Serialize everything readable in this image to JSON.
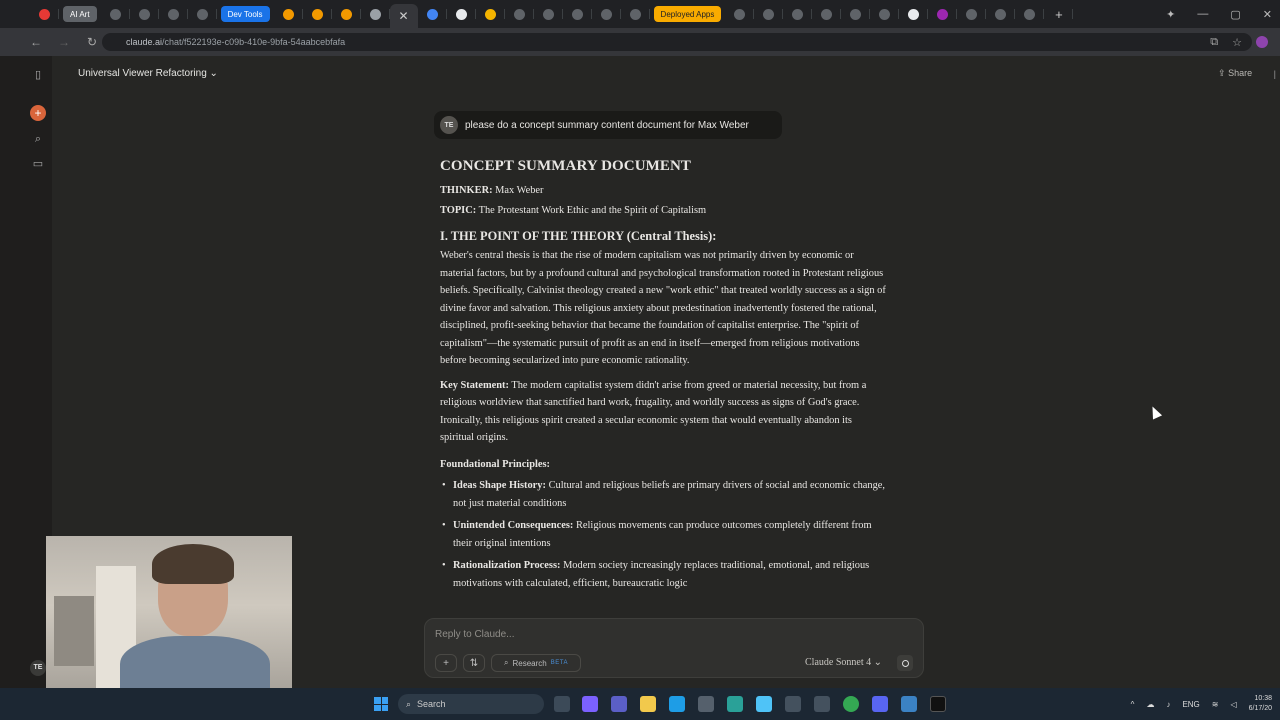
{
  "browser": {
    "pinned_tabs": [
      "AI Art",
      "Dev Tools",
      "Deployed Apps"
    ],
    "url_host": "claude.ai",
    "url_path": "/chat/f522193e-c09b-410e-9bfa-54aabcebfafa"
  },
  "header": {
    "chat_title": "Universal Viewer Refactoring",
    "share_label": "Share"
  },
  "user": {
    "initials": "TE",
    "message": "please do a  concept summary content document for Max Weber"
  },
  "document": {
    "title": "CONCEPT SUMMARY DOCUMENT",
    "thinker_label": "THINKER:",
    "thinker": "Max Weber",
    "topic_label": "TOPIC:",
    "topic": "The Protestant Work Ethic and the Spirit of Capitalism",
    "section1_heading": "I. THE POINT OF THE THEORY (Central Thesis):",
    "section1_body": "Weber's central thesis is that the rise of modern capitalism was not primarily driven by economic or material factors, but by a profound cultural and psychological transformation rooted in Protestant religious beliefs. Specifically, Calvinist theology created a new \"work ethic\" that treated worldly success as a sign of divine favor and salvation. This religious anxiety about predestination inadvertently fostered the rational, disciplined, profit-seeking behavior that became the foundation of capitalist enterprise. The \"spirit of capitalism\"—the systematic pursuit of profit as an end in itself—emerged from religious motivations before becoming secularized into pure economic rationality.",
    "key_label": "Key Statement:",
    "key_body": "The modern capitalist system didn't arise from greed or material necessity, but from a religious worldview that sanctified hard work, frugality, and worldly success as signs of God's grace. Ironically, this religious spirit created a secular economic system that would eventually abandon its spiritual origins.",
    "principles_heading": "Foundational Principles:",
    "principles": [
      {
        "label": "Ideas Shape History:",
        "text": "Cultural and religious beliefs are primary drivers of social and economic change, not just material conditions"
      },
      {
        "label": "Unintended Consequences:",
        "text": "Religious movements can produce outcomes completely different from their original intentions"
      },
      {
        "label": "Rationalization Process:",
        "text": "Modern society increasingly replaces traditional, emotional, and religious motivations with calculated, efficient, bureaucratic logic"
      }
    ]
  },
  "composer": {
    "placeholder": "Reply to Claude...",
    "research_label": "Research",
    "beta_label": "BETA",
    "model_label": "Claude Sonnet 4"
  },
  "taskbar": {
    "search_placeholder": "Search",
    "lang": "ENG",
    "time": "10:38",
    "date": "6/17/20"
  },
  "colors": {
    "background": "#262624",
    "accent": "#d9653b",
    "taskbar": "#1c2733"
  }
}
